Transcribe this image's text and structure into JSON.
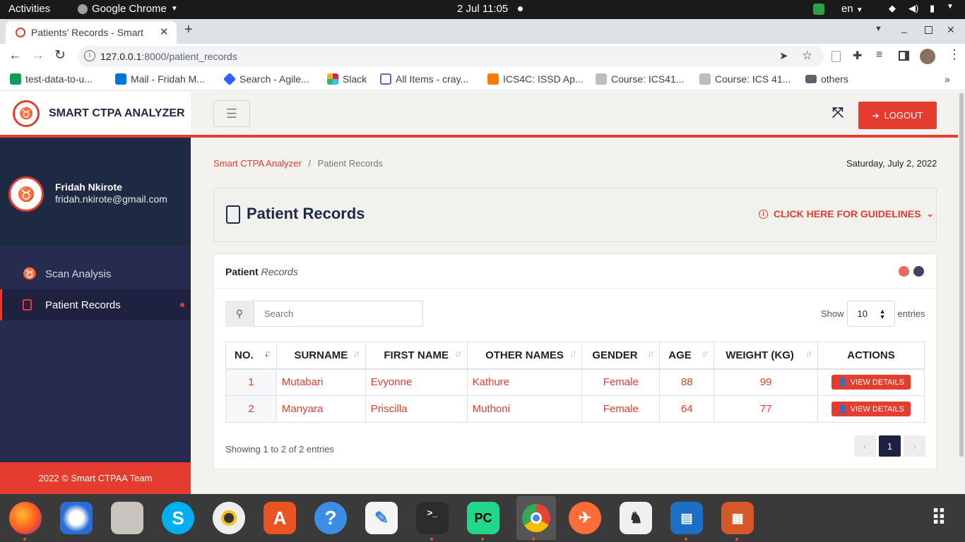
{
  "system": {
    "activities": "Activities",
    "app_menu": "Google Chrome",
    "clock": "2 Jul  11:05",
    "lang": "en"
  },
  "browser": {
    "tab_title": "Patients' Records - Smart",
    "url_host": "127.0.0.1",
    "url_path": ":8000/patient_records",
    "bookmarks": [
      {
        "label": "test-data-to-u...",
        "color": "#0f9d58"
      },
      {
        "label": "Mail - Fridah M...",
        "color": "#0078d4"
      },
      {
        "label": "Search - Agile...",
        "color": "#2962ff"
      },
      {
        "label": "Slack",
        "color": "#e01e5a"
      },
      {
        "label": "All Items - cray...",
        "color": "#5c6bc0"
      },
      {
        "label": "ICS4C: ISSD Ap...",
        "color": "#f57c00"
      },
      {
        "label": "Course: ICS41...",
        "color": "#9e9e9e"
      },
      {
        "label": "Course: ICS 41...",
        "color": "#9e9e9e"
      },
      {
        "label": "others",
        "color": "#5f6368"
      }
    ]
  },
  "app": {
    "brand": "SMART CTPA ANALYZER",
    "logout": "LOGOUT",
    "user": {
      "name": "Fridah Nkirote",
      "email": "fridah.nkirote@gmail.com"
    },
    "nav": [
      {
        "label": "Scan Analysis"
      },
      {
        "label": "Patient Records"
      }
    ],
    "footer": "2022 © Smart CTPAA Team",
    "breadcrumb": {
      "root": "Smart CTPA Analyzer",
      "sep": "/",
      "current": "Patient Records"
    },
    "date": "Saturday, July 2, 2022",
    "page_title": "Patient Records",
    "guidelines": "CLICK HERE FOR GUIDELINES",
    "card_title": {
      "bold": "Patient",
      "italic": "Records"
    },
    "search_placeholder": "Search",
    "show": "Show",
    "entries_value": "10",
    "entries": "entries",
    "table": {
      "headers": [
        "NO.",
        "SURNAME",
        "FIRST NAME",
        "OTHER NAMES",
        "GENDER",
        "AGE",
        "WEIGHT (KG)",
        "ACTIONS"
      ],
      "rows": [
        {
          "no": "1",
          "surname": "Mutabari",
          "first": "Evyonne",
          "other": "Kathure",
          "gender": "Female",
          "age": "88",
          "weight": "99",
          "action": "VIEW DETAILS"
        },
        {
          "no": "2",
          "surname": "Manyara",
          "first": "Priscilla",
          "other": "Muthoni",
          "gender": "Female",
          "age": "64",
          "weight": "77",
          "action": "VIEW DETAILS"
        }
      ]
    },
    "showing": "Showing 1 to 2 of 2 entries",
    "page": "1"
  }
}
